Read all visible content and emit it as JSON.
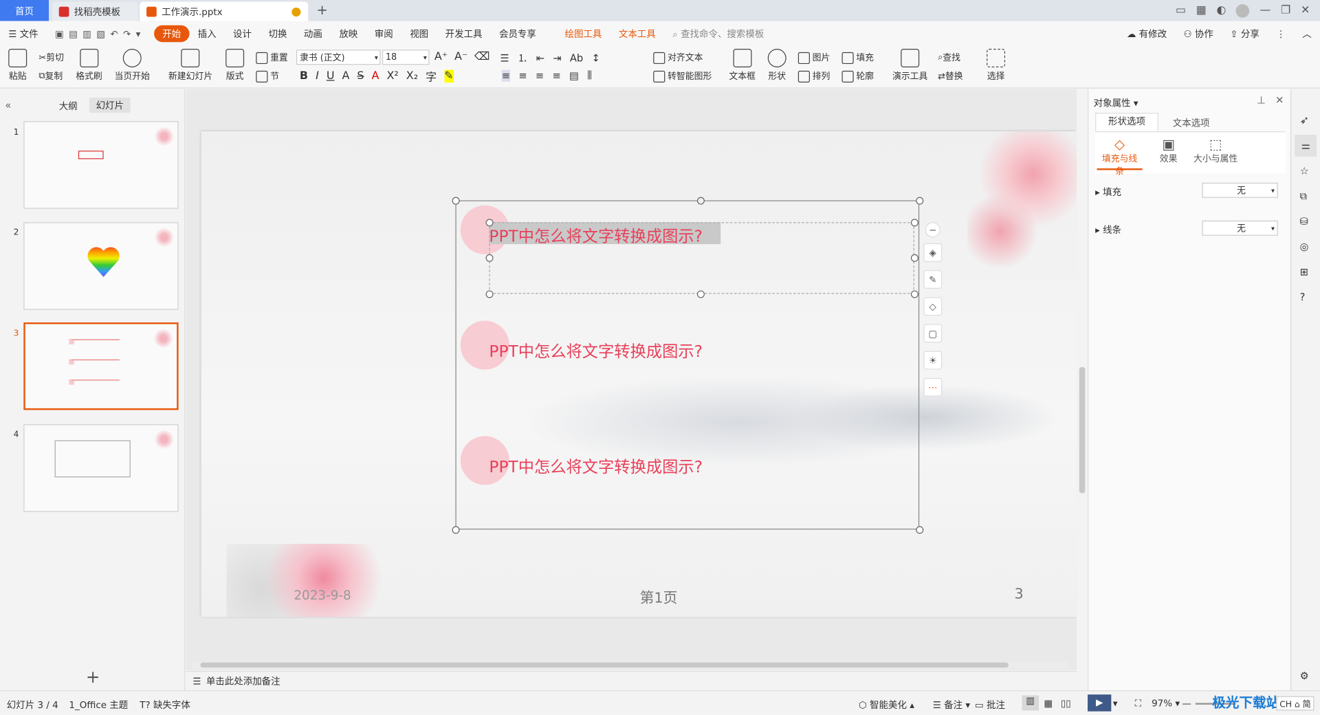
{
  "tabs": {
    "home": "首页",
    "template": "找稻壳模板",
    "doc": "工作演示.pptx",
    "new_tab": "+"
  },
  "menu": {
    "file": "文件",
    "items": [
      "开始",
      "插入",
      "设计",
      "切换",
      "动画",
      "放映",
      "审阅",
      "视图",
      "开发工具",
      "会员专享",
      "绘图工具",
      "文本工具"
    ],
    "search": "查找命令、搜索模板",
    "modified": "有修改",
    "collab": "协作",
    "share": "分享"
  },
  "ribbon": {
    "paste": "粘贴",
    "cut": "剪切",
    "copy": "复制",
    "format_painter": "格式刷",
    "play_from": "当页开始",
    "new_slide": "新建幻灯片",
    "layout": "版式",
    "reset": "重置",
    "section": "节",
    "font_name": "隶书 (正文)",
    "font_size": "18",
    "align_text": "对齐文本",
    "smartart": "转智能图形",
    "textbox": "文本框",
    "shape": "形状",
    "picture": "图片",
    "fill": "填充",
    "arrange": "排列",
    "outline": "轮廓",
    "present_tools": "演示工具",
    "find": "查找",
    "replace": "替换",
    "select": "选择"
  },
  "leftpane": {
    "outline_tab": "大纲",
    "slides_tab": "幻灯片",
    "slide_numbers": [
      "1",
      "2",
      "3",
      "4"
    ],
    "add": "+"
  },
  "slide": {
    "items": [
      "PPT中怎么将文字转换成图示?",
      "PPT中怎么将文字转换成图示?",
      "PPT中怎么将文字转换成图示?"
    ],
    "date": "2023-9-8",
    "page_label": "第1页",
    "page_number": "3",
    "accent": "#e8405a"
  },
  "notes": {
    "placeholder": "单击此处添加备注"
  },
  "rpanel": {
    "title": "对象属性",
    "tab_shape": "形状选项",
    "tab_text": "文本选项",
    "sub_fill": "填充与线条",
    "sub_effect": "效果",
    "sub_size": "大小与属性",
    "fill_label": "填充",
    "fill_value": "无",
    "line_label": "线条",
    "line_value": "无"
  },
  "status": {
    "slide_count": "幻灯片 3 / 4",
    "theme": "1_Office 主题",
    "missing_font": "缺失字体",
    "beautify": "智能美化",
    "notes": "备注",
    "comment": "批注",
    "zoom": "97%",
    "watermark": "极光下载站",
    "ime": "CH ⌂ 简"
  }
}
